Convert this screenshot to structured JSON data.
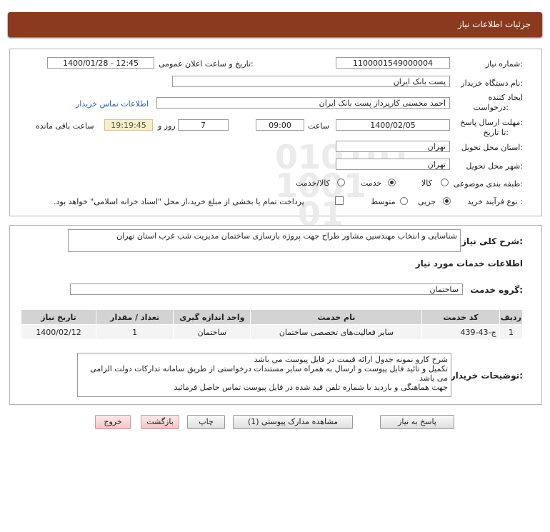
{
  "header": {
    "title": "جزئیات اطلاعات نیاز"
  },
  "labels": {
    "need_number": "شماره نیاز:",
    "announce_datetime": "تاریخ و ساعت اعلان عمومی:",
    "buyer_org": "نام دستگاه خریدار:",
    "creator_line1": "ایجاد کننده",
    "creator_line2": "درخواست:",
    "contact_link": "اطلاعات تماس خریدار",
    "deadline_line1": "مهلت ارسال پاسخ:",
    "deadline_line2": "تا تاریخ:",
    "time": "ساعت",
    "days_and": "روز و",
    "remaining": "ساعت باقی مانده",
    "province": "استان محل تحویل:",
    "city": "شهر محل تحویل:",
    "category": "طبقه بندی موضوعی:",
    "process_type": "نوع فرآیند خرید :",
    "general_desc": "شرح کلی نیاز:",
    "services_info": "اطلاعات خدمات مورد نیاز",
    "service_group": "گروه خدمت:",
    "buyer_notes": "توضیحات خریدار:"
  },
  "values": {
    "need_number": "1100001549000004",
    "announce_datetime": "1400/01/28 - 12:45",
    "buyer_org": "پست بانک ایران",
    "creator": "احمد  محسنی کارپرداز پست بانک ایران",
    "deadline_date": "1400/02/05",
    "deadline_time": "09:00",
    "days": "7",
    "remaining_time": "19:19:45",
    "province": "تهران",
    "city": "تهران",
    "general_desc": "شناسایی و انتخاب مهندسین مشاور طراح جهت پروژه بازسازی ساختمان مدیریت شب غرب استان تهران",
    "service_group": "ساختمان"
  },
  "category_options": [
    {
      "label": "کالا",
      "selected": false
    },
    {
      "label": "خدمت",
      "selected": true
    },
    {
      "label": "کالا/خدمت",
      "selected": false
    }
  ],
  "process_options": [
    {
      "label": "جزیی",
      "selected": true
    },
    {
      "label": "متوسط",
      "selected": false
    }
  ],
  "payment_note": "پرداخت تمام یا بخشی از مبلغ خرید،از محل \"اسناد خزانه اسلامی\" خواهد بود.",
  "table": {
    "headers": [
      "ردیف",
      "کد خدمت",
      "نام خدمت",
      "واحد اندازه گیری",
      "تعداد / مقدار",
      "تاریخ نیاز"
    ],
    "rows": [
      [
        "1",
        "ج-43-439",
        "سایر فعالیت‌های تخصصی ساختمان",
        "ساختمان",
        "1",
        "1400/02/12"
      ]
    ]
  },
  "buyer_notes": [
    "شرح کارو نمونه جدول ارائه قیمت در فایل پیوست می باشد",
    "تکمیل و تائید فایل پیوست و ارسال به همراه سایر مستندات درخواستی از طریق سامانه تدارکات دولت الزامی می باشد",
    "جهت هماهنگی و بازدید با شماره تلفن قید شده در فایل پیوست تماس حاصل فرمائید"
  ],
  "buttons": {
    "reply": "پاسخ به نیاز",
    "attachments": "مشاهده مدارک پیوستی (1)",
    "print": "چاپ",
    "back": "بازگشت",
    "exit": "خروج"
  }
}
